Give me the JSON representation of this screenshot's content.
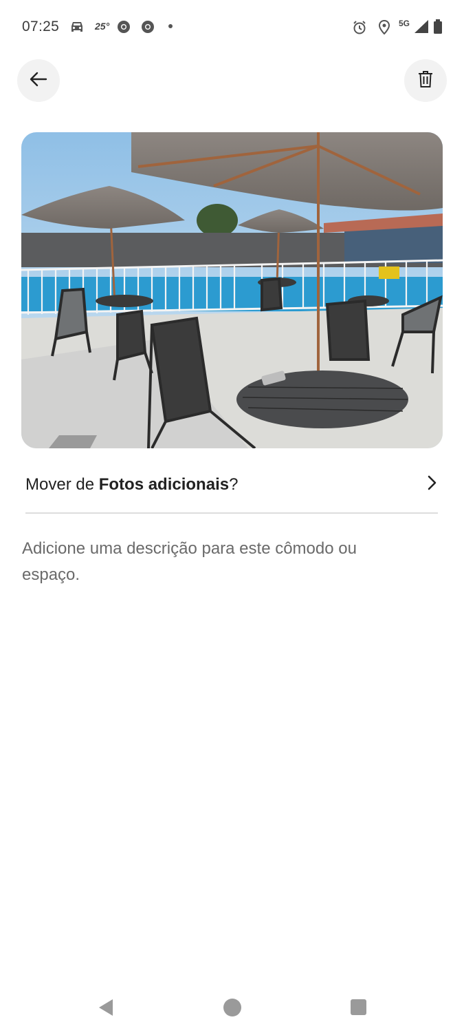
{
  "status_bar": {
    "time": "07:25",
    "temperature": "25°",
    "network": "5G",
    "icons": [
      "car-icon",
      "chrome-icon",
      "chrome-icon",
      "alarm-icon",
      "location-icon",
      "signal-icon",
      "battery-icon"
    ]
  },
  "header": {
    "back_icon": "arrow-left-icon",
    "delete_icon": "trash-icon"
  },
  "photo": {
    "subject": "patio-with-umbrellas-and-pool"
  },
  "move_row": {
    "prefix": "Mover de ",
    "album": "Fotos adicionais",
    "suffix": "?"
  },
  "description": {
    "placeholder": "Adicione uma descrição para este cômodo ou espaço."
  },
  "nav_bar": {
    "icons": [
      "nav-back-icon",
      "nav-home-icon",
      "nav-recents-icon"
    ]
  }
}
